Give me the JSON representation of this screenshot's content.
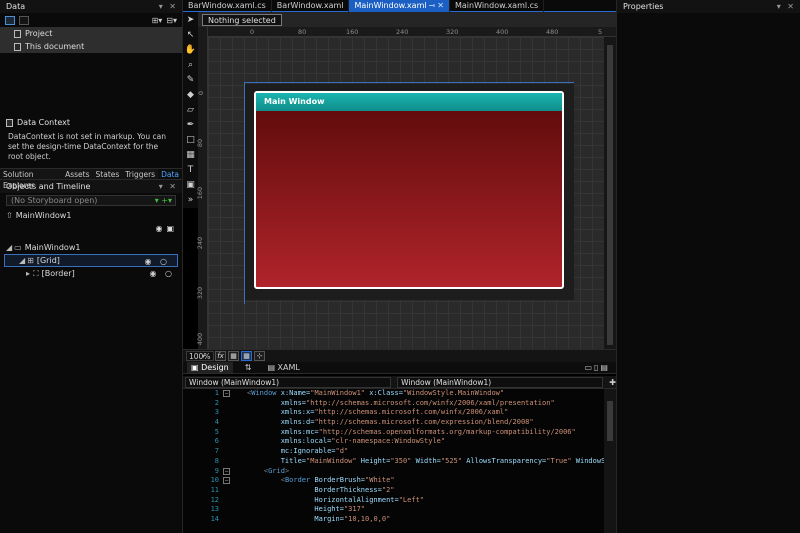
{
  "left_panel": {
    "data_header": {
      "title": "Data"
    },
    "data_items": [
      {
        "label": "Project"
      },
      {
        "label": "This document"
      }
    ],
    "data_context": {
      "title": "Data Context",
      "text": "DataContext is not set in markup. You can set the design-time DataContext for the root object."
    },
    "tabs": [
      {
        "label": "Solution Explorer"
      },
      {
        "label": "Assets"
      },
      {
        "label": "States"
      },
      {
        "label": "Triggers"
      },
      {
        "label": "Data"
      }
    ],
    "objects_header": {
      "title": "Objects and Timeline"
    },
    "storyboard_placeholder": "(No Storyboard open)",
    "root_scope": "MainWindow1",
    "tree": [
      {
        "label": "MainWindow1"
      },
      {
        "label": "[Grid]"
      },
      {
        "label": "[Border]"
      }
    ]
  },
  "doc_tabs": [
    {
      "label": "BarWindow.xaml.cs"
    },
    {
      "label": "BarWindow.xaml"
    },
    {
      "label": "MainWindow.xaml"
    },
    {
      "label": "MainWindow.xaml.cs"
    }
  ],
  "design": {
    "selection_status": "Nothing selected",
    "ruler_top": [
      "0",
      "80",
      "160",
      "240",
      "320",
      "400",
      "480",
      "5"
    ],
    "ruler_left": [
      "0",
      "80",
      "160",
      "240",
      "320",
      "400"
    ],
    "window_title": "Main Window",
    "zoom": "100%",
    "fx_label": "fx"
  },
  "view_tabs": {
    "design": "Design",
    "split": "⇅",
    "xaml": "XAML"
  },
  "code_header": {
    "left_selector": "Window (MainWindow1)",
    "right_selector": "Window (MainWindow1)"
  },
  "code_lines": [
    {
      "n": "1",
      "text": "<Window x:Name=\"MainWindow1\" x:Class=\"WindowStyle.MainWindow\""
    },
    {
      "n": "2",
      "text": "        xmlns=\"http://schemas.microsoft.com/winfx/2006/xaml/presentation\""
    },
    {
      "n": "3",
      "text": "        xmlns:x=\"http://schemas.microsoft.com/winfx/2006/xaml\""
    },
    {
      "n": "4",
      "text": "        xmlns:d=\"http://schemas.microsoft.com/expression/blend/2008\""
    },
    {
      "n": "5",
      "text": "        xmlns:mc=\"http://schemas.openxmlformats.org/markup-compatibility/2006\""
    },
    {
      "n": "6",
      "text": "        xmlns:local=\"clr-namespace:WindowStyle\""
    },
    {
      "n": "7",
      "text": "        mc:Ignorable=\"d\""
    },
    {
      "n": "8",
      "text": "        Title=\"MainWindow\" Height=\"350\" Width=\"525\" AllowsTransparency=\"True\" WindowSt"
    },
    {
      "n": "9",
      "text": "    <Grid>"
    },
    {
      "n": "10",
      "text": "        <Border BorderBrush=\"White\""
    },
    {
      "n": "11",
      "text": "                BorderThickness=\"2\""
    },
    {
      "n": "12",
      "text": "                HorizontalAlignment=\"Left\""
    },
    {
      "n": "13",
      "text": "                Height=\"317\""
    },
    {
      "n": "14",
      "text": "                Margin=\"10,10,0,0\""
    }
  ],
  "properties": {
    "title": "Properties"
  },
  "colors": {
    "accent": "#1c5fc4",
    "window_title_bar": "#13a3a0",
    "window_body_top": "#5a0a0a",
    "window_body_bottom": "#b0242a"
  }
}
